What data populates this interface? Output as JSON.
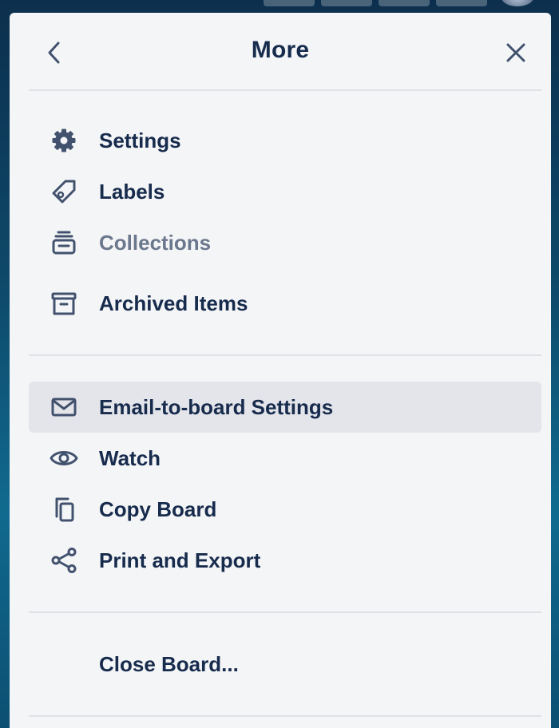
{
  "header": {
    "title": "More",
    "back_icon": "chevron-left-icon",
    "close_icon": "close-icon"
  },
  "menu_group_1": [
    {
      "label": "Settings",
      "icon": "gear-icon"
    },
    {
      "label": "Labels",
      "icon": "tag-icon"
    },
    {
      "label": "Collections",
      "icon": "collections-icon",
      "disabled": true
    },
    {
      "label": "Archived Items",
      "icon": "archive-icon"
    }
  ],
  "menu_group_2": [
    {
      "label": "Email-to-board Settings",
      "icon": "email-icon",
      "highlighted": true
    },
    {
      "label": "Watch",
      "icon": "eye-icon"
    },
    {
      "label": "Copy Board",
      "icon": "copy-icon"
    },
    {
      "label": "Print and Export",
      "icon": "share-icon"
    }
  ],
  "menu_group_3": [
    {
      "label": "Close Board..."
    }
  ],
  "colors": {
    "panel_bg": "#f4f5f7",
    "text": "#172b4d",
    "muted_text": "#6b778c",
    "highlight_bg": "#e4e5ea",
    "divider": "#dfe1e6"
  }
}
